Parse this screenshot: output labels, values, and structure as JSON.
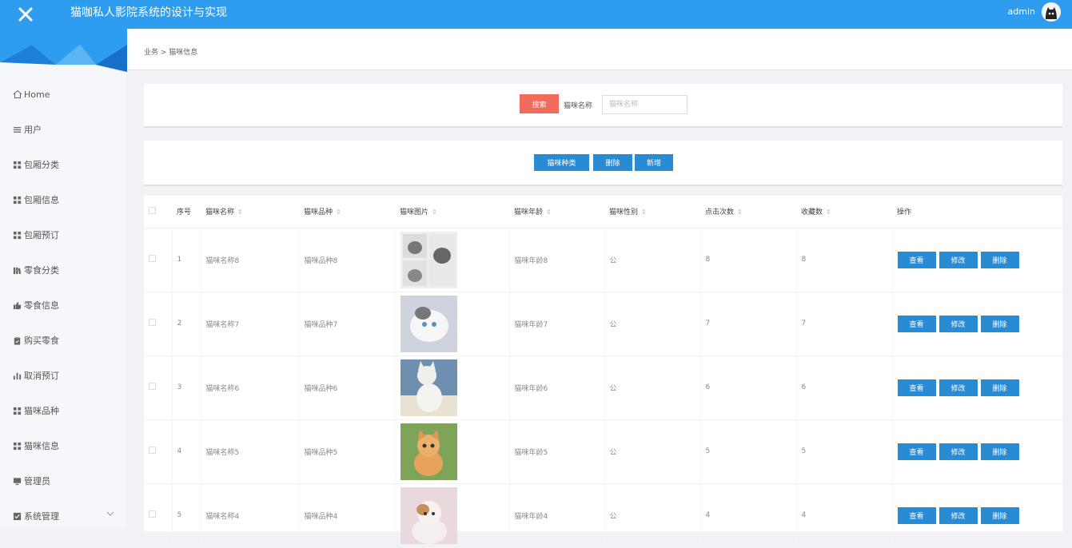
{
  "header": {
    "title": "猫咖私人影院系统的设计与实现",
    "user": "admin",
    "close_icon": "close-icon",
    "avatar_icon": "cat-avatar-icon"
  },
  "colors": {
    "topbar": "#2e9df0",
    "search_button": "#f26a5a",
    "action_button": "#2a8bd5"
  },
  "sidebar": {
    "items": [
      {
        "label": "Home",
        "icon": "home-icon"
      },
      {
        "label": "用户",
        "icon": "list-icon"
      },
      {
        "label": "包厢分类",
        "icon": "grid-icon"
      },
      {
        "label": "包厢信息",
        "icon": "grid-icon"
      },
      {
        "label": "包厢预订",
        "icon": "grid-icon"
      },
      {
        "label": "零食分类",
        "icon": "books-icon"
      },
      {
        "label": "零食信息",
        "icon": "thumbs-up-icon"
      },
      {
        "label": "购买零食",
        "icon": "clipboard-icon"
      },
      {
        "label": "取消预订",
        "icon": "bar-chart-icon"
      },
      {
        "label": "猫咪品种",
        "icon": "grid-icon"
      },
      {
        "label": "猫咪信息",
        "icon": "grid-icon"
      },
      {
        "label": "管理员",
        "icon": "monitor-icon"
      },
      {
        "label": "系统管理",
        "icon": "checkbox-icon"
      }
    ]
  },
  "breadcrumb": "业务 > 猫咪信息",
  "search": {
    "button": "搜索",
    "label": "猫咪名称",
    "placeholder": "猫咪名称"
  },
  "actions": {
    "category": "猫咪种类",
    "delete": "删除",
    "add": "新增"
  },
  "table": {
    "headers": {
      "index": "序号",
      "name": "猫咪名称",
      "breed": "猫咪品种",
      "image": "猫咪图片",
      "age": "猫咪年龄",
      "gender": "猫咪性别",
      "clicks": "点击次数",
      "favorites": "收藏数",
      "ops": "操作"
    },
    "sort_icon": "sort-icon",
    "rows": [
      {
        "index": "1",
        "name": "猫咪名称8",
        "breed": "猫咪品种8",
        "age": "猫咪年龄8",
        "gender": "公",
        "clicks": "8",
        "favorites": "8"
      },
      {
        "index": "2",
        "name": "猫咪名称7",
        "breed": "猫咪品种7",
        "age": "猫咪年龄7",
        "gender": "公",
        "clicks": "7",
        "favorites": "7"
      },
      {
        "index": "3",
        "name": "猫咪名称6",
        "breed": "猫咪品种6",
        "age": "猫咪年龄6",
        "gender": "公",
        "clicks": "6",
        "favorites": "6"
      },
      {
        "index": "4",
        "name": "猫咪名称5",
        "breed": "猫咪品种5",
        "age": "猫咪年龄5",
        "gender": "公",
        "clicks": "5",
        "favorites": "5"
      },
      {
        "index": "5",
        "name": "猫咪名称4",
        "breed": "猫咪品种4",
        "age": "猫咪年龄4",
        "gender": "公",
        "clicks": "4",
        "favorites": "4"
      }
    ],
    "row_buttons": {
      "view": "查看",
      "edit": "修改",
      "delete": "删除"
    }
  }
}
